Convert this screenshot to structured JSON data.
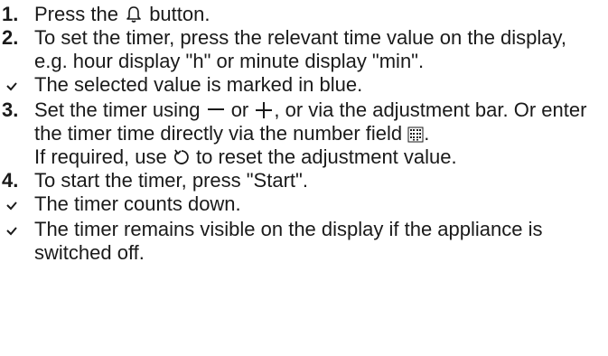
{
  "steps": {
    "s1": {
      "num": "1.",
      "before": "Press the",
      "after": "button."
    },
    "s2": {
      "num": "2.",
      "text": "To set the timer, press the relevant time value on the display, e.g. hour display \"h\" or minute display \"min\"."
    },
    "r1": {
      "text": "The selected value is marked in blue."
    },
    "s3": {
      "num": "3.",
      "a": "Set the timer using",
      "b": "or",
      "c": ", or via the adjustment bar. Or enter the timer time directly via the number field",
      "d": ".",
      "note_before": "If required, use",
      "note_after": "to reset the adjustment value."
    },
    "s4": {
      "num": "4.",
      "text": "To start the timer, press \"Start\"."
    },
    "r2": {
      "text": "The timer counts down."
    },
    "r3": {
      "text": "The timer remains visible on the display if the appli­ance is switched off."
    }
  },
  "icons": {
    "timer": "bell-timer-icon",
    "minus": "minus-icon",
    "plus": "plus-icon",
    "number_field": "number-field-icon",
    "reset": "reset-icon",
    "result": "checkmark-icon"
  }
}
